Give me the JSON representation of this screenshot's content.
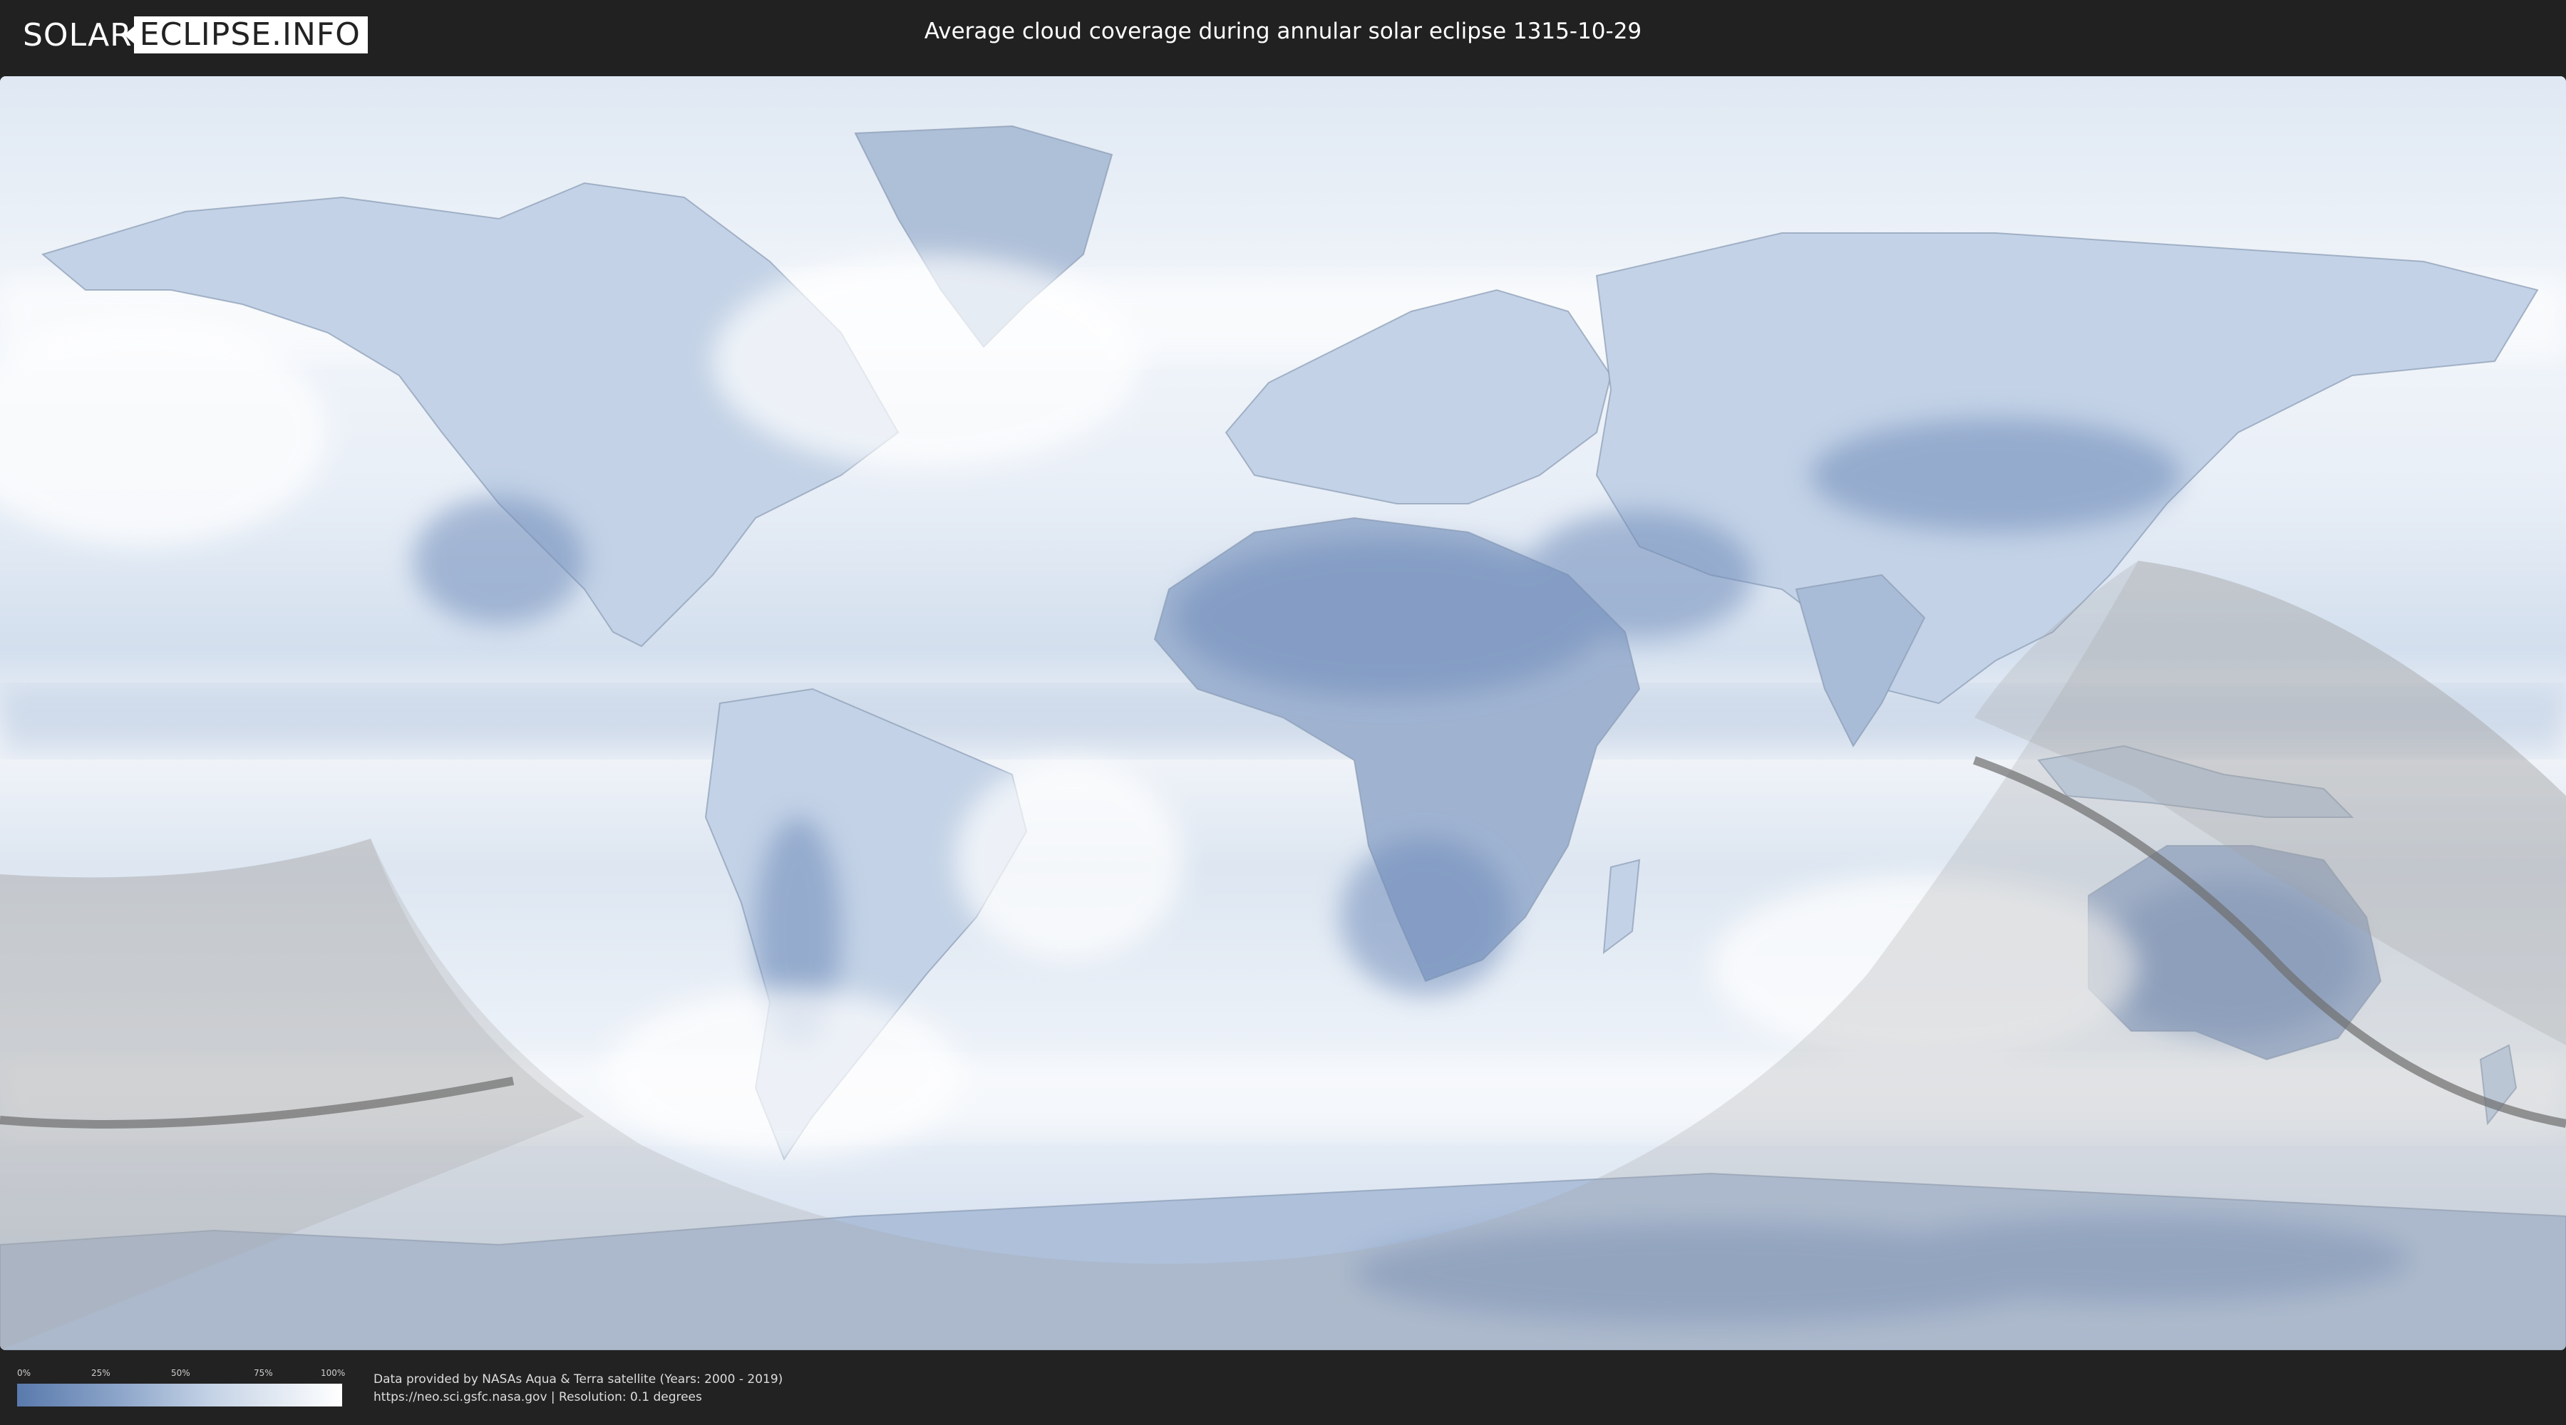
{
  "header": {
    "logo_part1": "SOLAR",
    "logo_part2": "ECLIPSE.INFO",
    "title": "Average cloud coverage during annular solar eclipse 1315-10-29"
  },
  "map": {
    "layer": "average cloud coverage",
    "colors": {
      "clear": "#5a7aad",
      "cloudy": "#ffffff",
      "shadow_overlay": "#b4b4b4",
      "path_line": "#6e6e6e"
    }
  },
  "legend": {
    "ticks": [
      "0%",
      "25%",
      "50%",
      "75%",
      "100%"
    ],
    "tick_values": [
      0,
      25,
      50,
      75,
      100
    ]
  },
  "footer": {
    "credit_line1": "Data provided by NASAs Aqua & Terra satellite (Years: 2000 - 2019)",
    "credit_line2": "https://neo.sci.gsfc.nasa.gov | Resolution: 0.1 degrees"
  }
}
